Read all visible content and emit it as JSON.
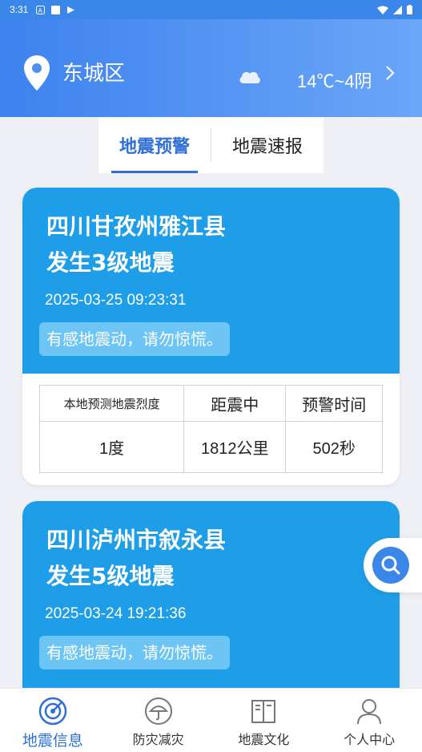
{
  "status_bar": {
    "time": "3:31"
  },
  "header": {
    "district": "东城区",
    "weather_text": "14℃~4阴"
  },
  "tabs": [
    {
      "label": "地震预警",
      "active": true
    },
    {
      "label": "地震速报",
      "active": false
    }
  ],
  "cards": [
    {
      "title_line1": "四川甘孜州雅江县",
      "title_line2": "发生3级地震",
      "time": "2025-03-25 09:23:31",
      "note": "有感地震动，请勿惊慌。",
      "table_headers": [
        "本地预测地震烈度",
        "距震中",
        "预警时间"
      ],
      "table_values": [
        "1度",
        "1812公里",
        "502秒"
      ]
    },
    {
      "title_line1": "四川泸州市叙永县",
      "title_line2": "发生5级地震",
      "time": "2025-03-24 19:21:36",
      "note": "有感地震动，请勿惊慌。"
    }
  ],
  "bottom_nav": [
    {
      "label": "地震信息",
      "icon": "radar-icon",
      "active": true
    },
    {
      "label": "防灾减灾",
      "icon": "umbrella-icon",
      "active": false
    },
    {
      "label": "地震文化",
      "icon": "book-icon",
      "active": false
    },
    {
      "label": "个人中心",
      "icon": "person-icon",
      "active": false
    }
  ],
  "colors": {
    "header_start": "#3d82ee",
    "header_end": "#6aa6f8",
    "card_blue": "#1e9ee8",
    "accent": "#2f6fd6"
  }
}
